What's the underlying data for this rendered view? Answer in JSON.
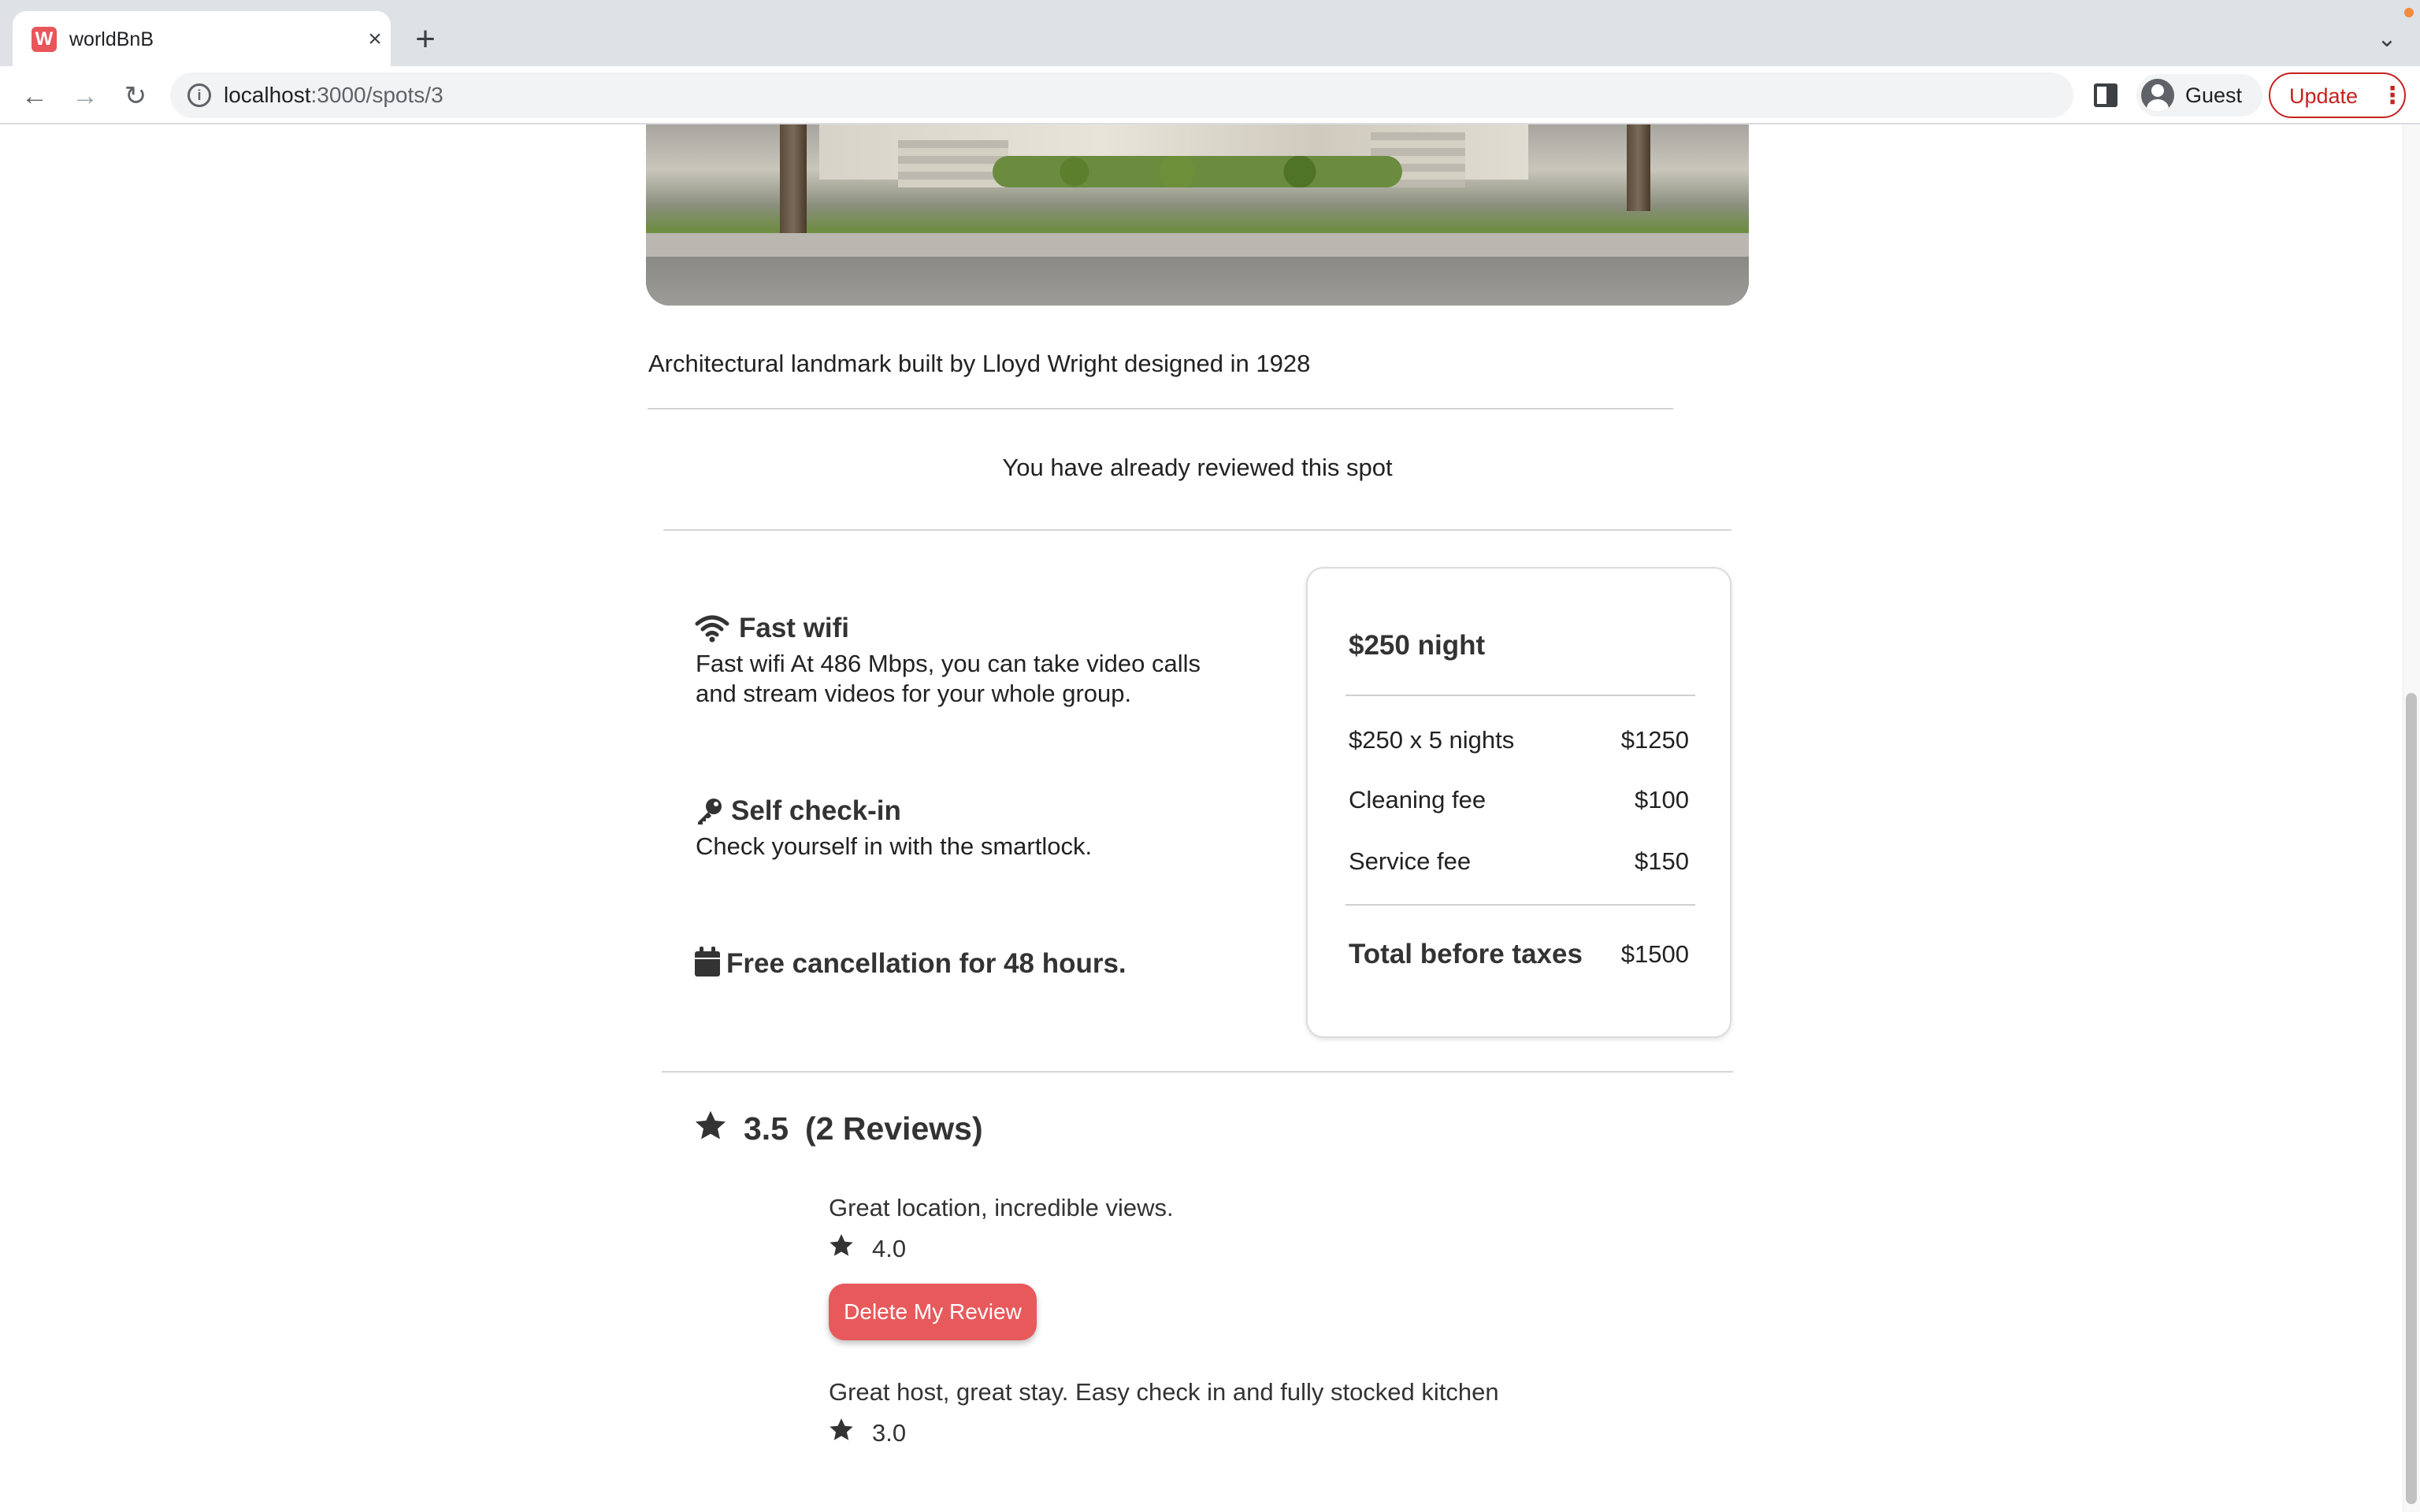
{
  "browser": {
    "tab_title": "worldBnB",
    "favicon_letter": "W",
    "close_glyph": "×",
    "new_tab_glyph": "+",
    "tab_menu_glyph": "⌄",
    "back_glyph": "←",
    "forward_glyph": "→",
    "reload_glyph": "↻",
    "info_glyph": "i",
    "url_host": "localhost",
    "url_path": ":3000/spots/3",
    "profile_name": "Guest",
    "update_label": "Update",
    "kebab_glyph": "⋮"
  },
  "spot": {
    "description": "Architectural landmark built by Lloyd Wright designed in 1928",
    "reviewed_message": "You have already reviewed this spot"
  },
  "amenities": [
    {
      "icon": "wifi-icon",
      "title": "Fast wifi",
      "text_line1": "Fast wifi At 486 Mbps, you can take video calls",
      "text_line2": "and stream videos for your whole group."
    },
    {
      "icon": "key-icon",
      "title": "Self check-in",
      "text_line1": "Check yourself in with the smartlock."
    },
    {
      "icon": "calendar-icon",
      "title": "Free cancellation for 48 hours."
    }
  ],
  "pricing": {
    "per_night": "$250 night",
    "rows": [
      {
        "label": "$250 x 5 nights",
        "value": "$1250"
      },
      {
        "label": "Cleaning fee",
        "value": "$100"
      },
      {
        "label": "Service fee",
        "value": "$150"
      }
    ],
    "total_label": "Total before taxes",
    "total_value": "$1500"
  },
  "reviews": {
    "average": "3.5",
    "count_label": "(2 Reviews)",
    "items": [
      {
        "text": "Great location, incredible views.",
        "stars": "4.0",
        "delete_label": "Delete My Review"
      },
      {
        "text": "Great host, great stay. Easy check in and fully stocked kitchen",
        "stars": "3.0"
      }
    ]
  },
  "colors": {
    "accent": "#e8595c",
    "update_red": "#c5221f"
  }
}
